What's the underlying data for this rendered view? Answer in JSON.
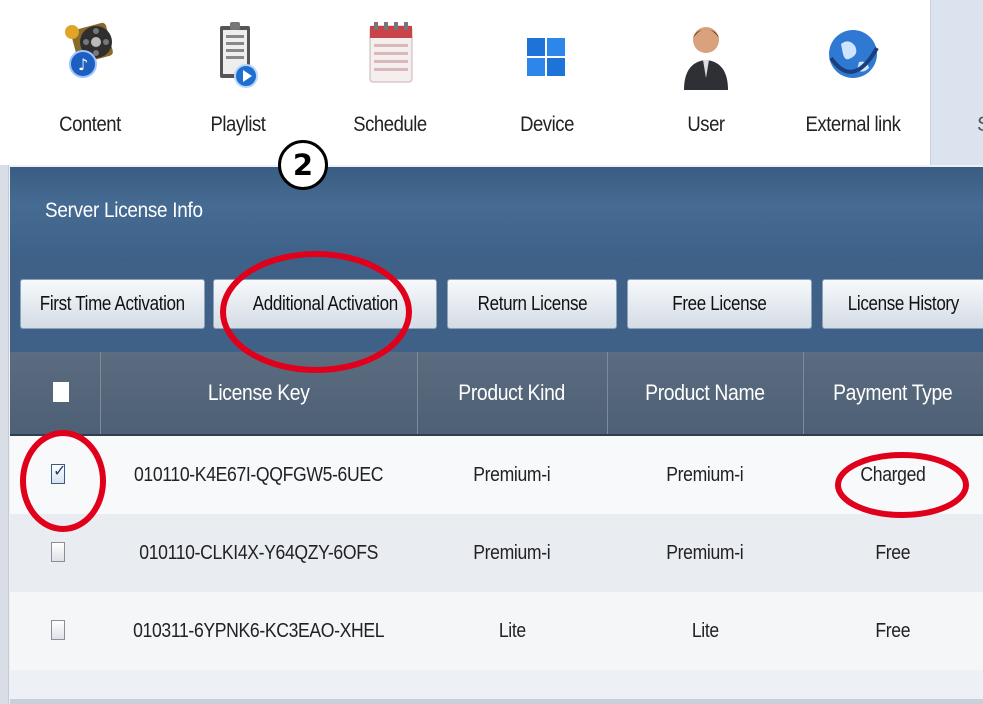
{
  "nav": {
    "items": [
      {
        "label": "Content",
        "icon": "content-media-icon"
      },
      {
        "label": "Playlist",
        "icon": "playlist-icon"
      },
      {
        "label": "Schedule",
        "icon": "schedule-calendar-icon"
      },
      {
        "label": "Device",
        "icon": "device-windows-icon"
      },
      {
        "label": "User",
        "icon": "user-icon"
      },
      {
        "label": "External link",
        "icon": "globe-link-icon"
      }
    ],
    "partial_label": "S"
  },
  "panel": {
    "title": "Server License Info"
  },
  "toolbar": {
    "first_time_activation": "First Time Activation",
    "additional_activation": "Additional Activation",
    "return_license": "Return License",
    "free_license": "Free License",
    "license_history": "License History"
  },
  "table": {
    "headers": {
      "license_key": "License Key",
      "product_kind": "Product Kind",
      "product_name": "Product Name",
      "payment_type": "Payment Type"
    },
    "rows": [
      {
        "checked": true,
        "license_key": "010110-K4E67I-QQFGW5-6UEC",
        "product_kind": "Premium-i",
        "product_name": "Premium-i",
        "payment_type": "Charged"
      },
      {
        "checked": false,
        "license_key": "010110-CLKI4X-Y64QZY-6OFS",
        "product_kind": "Premium-i",
        "product_name": "Premium-i",
        "payment_type": "Free"
      },
      {
        "checked": false,
        "license_key": "010311-6YPNK6-KC3EAO-XHEL",
        "product_kind": "Lite",
        "product_name": "Lite",
        "payment_type": "Free"
      }
    ]
  },
  "annotations": {
    "step_number": "2",
    "highlight_color": "#e0001b"
  }
}
